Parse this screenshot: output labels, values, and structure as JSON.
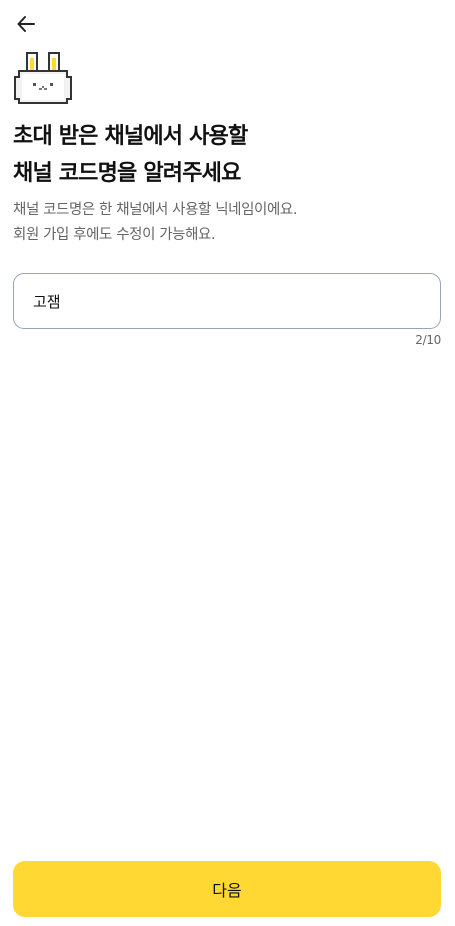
{
  "header": {
    "back_icon": "arrow-left-icon"
  },
  "mascot": {
    "icon": "pixel-rabbit-icon"
  },
  "title": {
    "line1": "초대 받은 채널에서 사용할",
    "line2": "채널 코드명을 알려주세요"
  },
  "description": {
    "line1": "채널 코드명은 한 채널에서 사용할 닉네임이에요.",
    "line2": "회원 가입 후에도 수정이 가능해요."
  },
  "nickname_field": {
    "value": "고잼",
    "counter": "2/10"
  },
  "next_button": {
    "label": "다음"
  },
  "colors": {
    "accent": "#FFD833",
    "field_border": "#9AA2B8",
    "text_primary": "#111111",
    "text_secondary": "#666666"
  }
}
